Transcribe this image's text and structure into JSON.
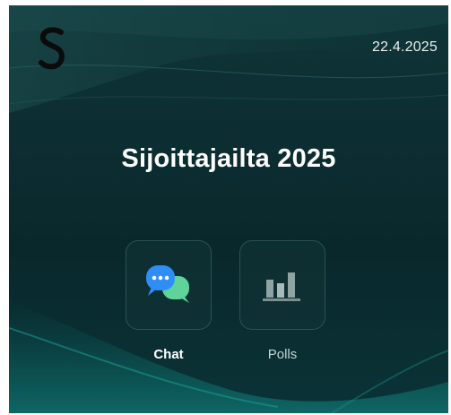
{
  "header": {
    "logo_icon": "s-logo-icon",
    "date": "22.4.2025"
  },
  "main": {
    "title": "Sijoittajailta 2025"
  },
  "tiles": [
    {
      "label": "Chat",
      "icon": "chat-bubbles-icon",
      "active": true
    },
    {
      "label": "Polls",
      "icon": "bar-chart-icon",
      "active": false
    }
  ],
  "colors": {
    "background": "#0c2d31",
    "chat_blue": "#2f8ef5",
    "chat_green": "#5fd39a",
    "polls_gray": "#8fa3a3"
  }
}
